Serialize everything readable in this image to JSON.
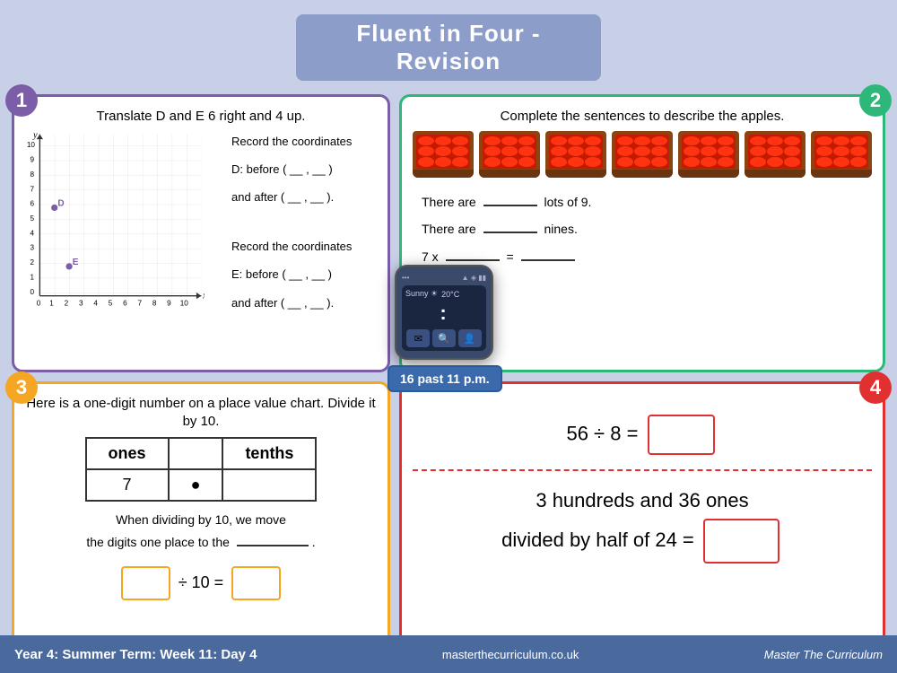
{
  "title": "Fluent in Four - Revision",
  "q1": {
    "badge": "1",
    "instruction": "Translate D and E 6 right and 4 up.",
    "coord_info1_title": "Record the coordinates",
    "coord_info1_d": "D: before ( __ , __ )",
    "coord_info1_d_after": "and after ( __ , __ ).",
    "coord_info2_title": "Record the coordinates",
    "coord_info2_e": "E: before ( __ , __ )",
    "coord_info2_e_after": "and after ( __ , __ ).",
    "point_d_label": "D",
    "point_e_label": "E"
  },
  "q2": {
    "badge": "2",
    "instruction": "Complete the sentences to describe the apples.",
    "sentence1": "There are _______ lots of 9.",
    "sentence2": "There are _______ nines.",
    "sentence3": "7 x _______ = _______",
    "num_crates": 7
  },
  "q3": {
    "badge": "3",
    "instruction": "Here is a one-digit number on a place value chart. Divide it by 10.",
    "col1": "ones",
    "col2": "tenths",
    "value": "7",
    "dot": "●",
    "sentence": "When dividing by 10, we move the digits one place to the _______.",
    "calc_prefix": "÷ 10 ="
  },
  "q4": {
    "badge": "4",
    "calc1": "56 ÷ 8 =",
    "calc2": "3 hundreds and 36 ones divided by half of 24 ="
  },
  "smartwatch": {
    "dots": "...",
    "signal_icons": "▲ ◈ ▮▮▮",
    "weather": "Sunny ☀",
    "temp": "20°C",
    "time": ":",
    "label": "16 past 11 p.m."
  },
  "footer": {
    "left": "Year 4: Summer Term: Week 11: Day 4",
    "center": "masterthecurriculum.co.uk",
    "right": "Master The Curriculum"
  }
}
